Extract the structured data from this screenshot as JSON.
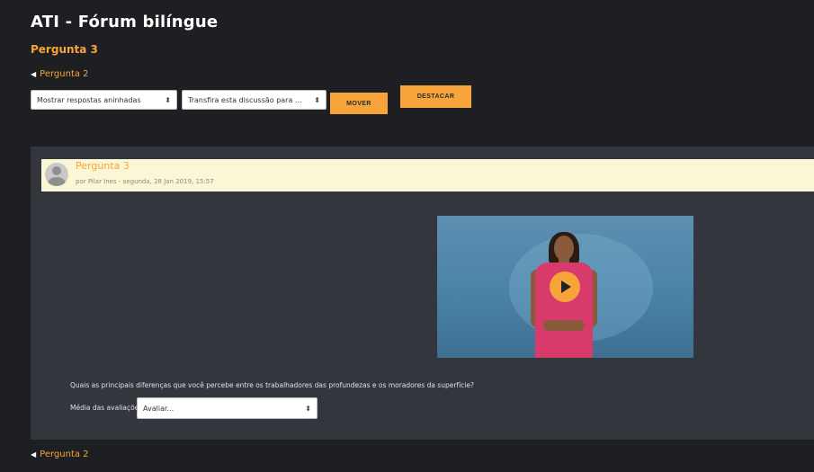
{
  "forum": {
    "title": "ATI - Fórum bilíngue"
  },
  "discussion": {
    "title": "Pergunta 3",
    "prev_link": "Pergunta 2"
  },
  "controls": {
    "display_mode": "Mostrar respostas aninhadas",
    "move_to": "Transfira esta discussão para ...",
    "move_button": "MOVER",
    "pin_button": "DESTACAR"
  },
  "post": {
    "subject": "Pergunta 3",
    "byline": "por Pilar Ines - segunda, 28 Jan 2019, 15:57",
    "question": "Quais as principais diferenças que você percebe entre os trabalhadores das profundezas e os moradores da superfície?",
    "rating_label": "Média das avaliações: -",
    "rating_value": "Avaliar..."
  },
  "video": {
    "play_icon": "play-icon"
  },
  "colors": {
    "accent": "#f7a43a",
    "background": "#1e1f23",
    "panel": "#33363c",
    "header": "#fbf6d3"
  }
}
